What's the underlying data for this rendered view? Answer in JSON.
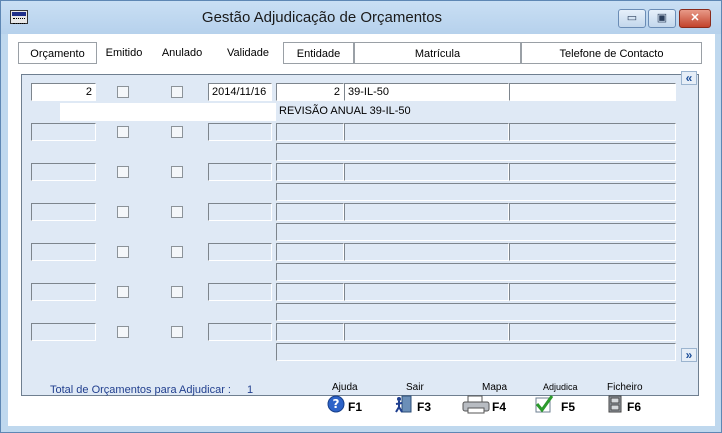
{
  "window": {
    "title": "Gestão  Adjudicação de Orçamentos",
    "minimize_glyph": "▭",
    "maximize_glyph": "▣",
    "close_glyph": "✕"
  },
  "columns": [
    {
      "label": "Orçamento",
      "boxed": true
    },
    {
      "label": "Emitido",
      "boxed": false
    },
    {
      "label": "Anulado",
      "boxed": false
    },
    {
      "label": "Validade",
      "boxed": false
    },
    {
      "label": "Entidade",
      "boxed": true
    },
    {
      "label": "Matrícula",
      "boxed": true
    },
    {
      "label": "Telefone de Contacto",
      "boxed": true
    }
  ],
  "rows": [
    {
      "orcamento": "2",
      "validade": "2014/11/16",
      "entidade": "2",
      "matricula": "39-IL-50",
      "telefone": "",
      "descricao": "REVISÃO ANUAL 39-IL-50",
      "filled": true
    },
    {
      "orcamento": "",
      "validade": "",
      "entidade": "",
      "matricula": "",
      "telefone": "",
      "descricao": "",
      "filled": false
    },
    {
      "orcamento": "",
      "validade": "",
      "entidade": "",
      "matricula": "",
      "telefone": "",
      "descricao": "",
      "filled": false
    },
    {
      "orcamento": "",
      "validade": "",
      "entidade": "",
      "matricula": "",
      "telefone": "",
      "descricao": "",
      "filled": false
    },
    {
      "orcamento": "",
      "validade": "",
      "entidade": "",
      "matricula": "",
      "telefone": "",
      "descricao": "",
      "filled": false
    },
    {
      "orcamento": "",
      "validade": "",
      "entidade": "",
      "matricula": "",
      "telefone": "",
      "descricao": "",
      "filled": false
    },
    {
      "orcamento": "",
      "validade": "",
      "entidade": "",
      "matricula": "",
      "telefone": "",
      "descricao": "",
      "filled": false
    }
  ],
  "scroll": {
    "up_glyph": "«",
    "down_glyph": "»"
  },
  "footer": {
    "total_label": "Total de Orçamentos para Adjudicar :",
    "total_value": "1"
  },
  "buttons": [
    {
      "label": "Ajuda",
      "key": "F1",
      "icon": "help-icon"
    },
    {
      "label": "Sair",
      "key": "F3",
      "icon": "exit-door-icon"
    },
    {
      "label": "Mapa",
      "key": "F4",
      "icon": "printer-icon"
    },
    {
      "label": "Adjudica",
      "key": "F5",
      "icon": "checkmark-icon"
    },
    {
      "label": "Ficheiro",
      "key": "F6",
      "icon": "file-cabinet-icon"
    }
  ]
}
